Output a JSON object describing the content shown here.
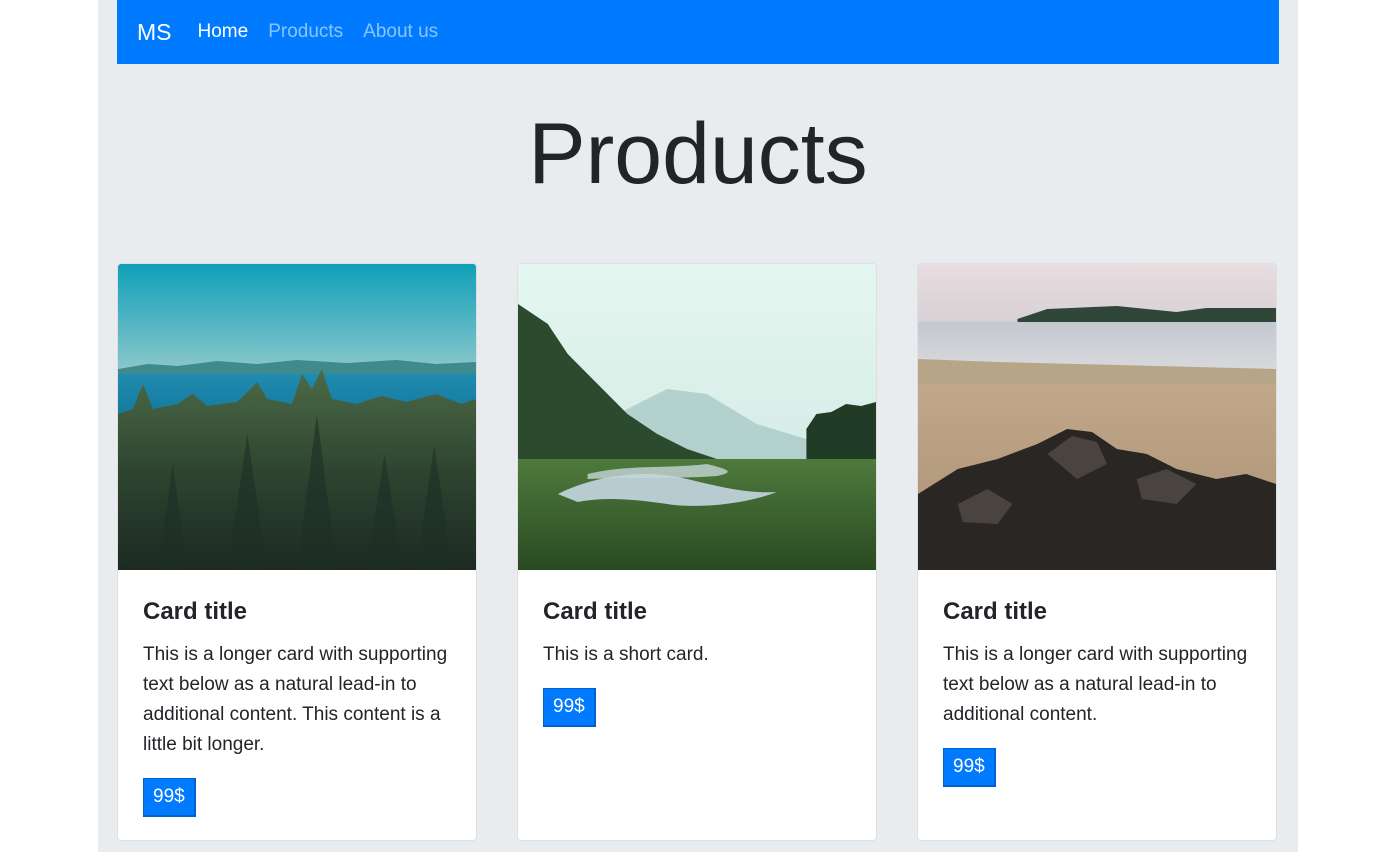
{
  "navbar": {
    "brand": "MS",
    "links": [
      {
        "label": "Home",
        "active": true
      },
      {
        "label": "Products",
        "active": false
      },
      {
        "label": "About us",
        "active": false
      }
    ],
    "background_color": "#007bff"
  },
  "main": {
    "title": "Products",
    "background_color": "#e9ecef"
  },
  "cards": [
    {
      "image_description": "forest-lake-landscape",
      "title": "Card title",
      "text": "This is a longer card with supporting text below as a natural lead-in to additional content. This content is a little bit longer.",
      "price": "99$"
    },
    {
      "image_description": "misty-valley-river",
      "title": "Card title",
      "text": "This is a short card.",
      "price": "99$"
    },
    {
      "image_description": "rocky-beach-island",
      "title": "Card title",
      "text": "This is a longer card with supporting text below as a natural lead-in to additional content.",
      "price": "99$"
    }
  ]
}
